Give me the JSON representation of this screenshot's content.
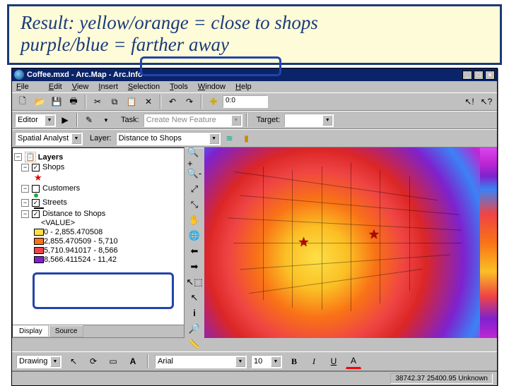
{
  "slide": {
    "line1": "Result: yellow/orange = close to shops",
    "line2": "purple/blue = farther away"
  },
  "titlebar": {
    "text": "Coffee.mxd - Arc.Map - Arc.Info"
  },
  "menu": {
    "file": "File",
    "edit": "Edit",
    "view": "View",
    "insert": "Insert",
    "selection": "Selection",
    "tools": "Tools",
    "window": "Window",
    "help": "Help"
  },
  "toolbar1": {
    "coord": "0:0"
  },
  "toolbar2": {
    "editor": "Editor",
    "task_label": "Task:",
    "task_value": "Create New Feature",
    "target_label": "Target:"
  },
  "toolbar3": {
    "spatial": "Spatial Analyst",
    "layer_label": "Layer:",
    "layer_value": "Distance to Shops"
  },
  "toc": {
    "layers": "Layers",
    "shops": "Shops",
    "customers": "Customers",
    "streets": "Streets",
    "dist": "Distance to Shops",
    "value": "<VALUE>",
    "classes": [
      {
        "color": "#fde047",
        "label": "0 - 2,855.470508"
      },
      {
        "color": "#f97316",
        "label": "2,855.470509 - 5,710"
      },
      {
        "color": "#ef4444",
        "label": "5,710.941017 - 8,566"
      },
      {
        "color": "#7e22ce",
        "label": "8,566.411524 - 11,42"
      }
    ],
    "display_tab": "Display",
    "source_tab": "Source"
  },
  "draw": {
    "label": "Drawing",
    "font": "Arial",
    "size": "10",
    "b": "B",
    "i": "I",
    "u": "U",
    "a": "A"
  },
  "status": {
    "coords": "38742.37  25400.95 Unknown"
  }
}
